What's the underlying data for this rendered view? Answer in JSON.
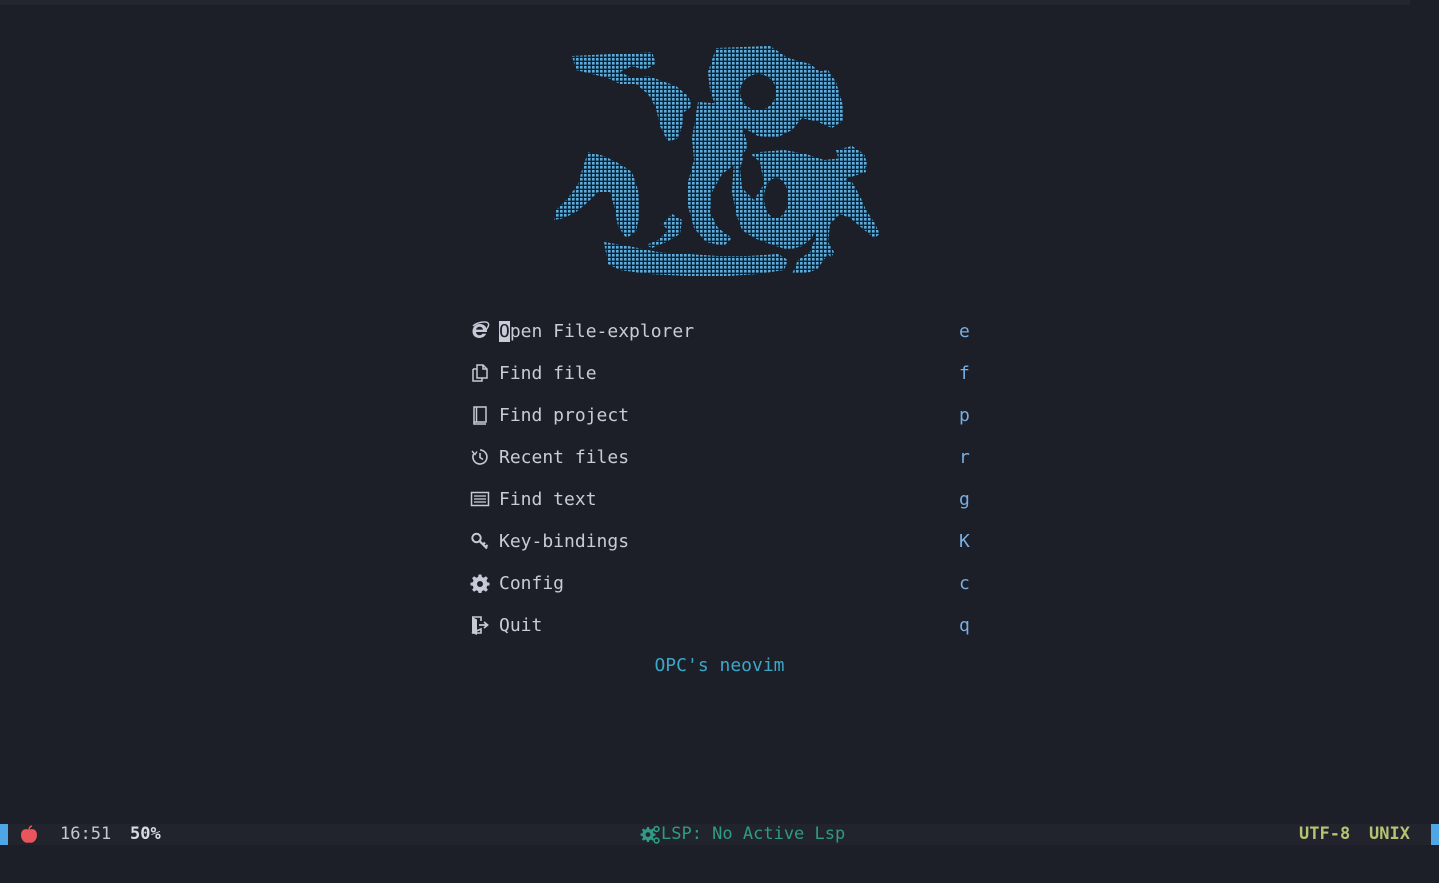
{
  "menu": [
    {
      "icon": "internet-explorer-icon",
      "label_first": "O",
      "label_rest": "pen File-explorer",
      "key": "e"
    },
    {
      "icon": "files-icon",
      "label": "Find file",
      "key": "f"
    },
    {
      "icon": "book-icon",
      "label": "Find project",
      "key": "p"
    },
    {
      "icon": "history-icon",
      "label": "Recent files",
      "key": "r"
    },
    {
      "icon": "text-lines-icon",
      "label": "Find text",
      "key": "g"
    },
    {
      "icon": "key-icon",
      "label": "Key-bindings",
      "key": "K"
    },
    {
      "icon": "gear-icon",
      "label": "Config",
      "key": "c"
    },
    {
      "icon": "exit-icon",
      "label": "Quit",
      "key": "q"
    }
  ],
  "footer": "OPC's neovim",
  "statusline": {
    "time": "16:51",
    "percent": "50%",
    "lsp": "LSP: No Active Lsp",
    "encoding": "UTF-8",
    "format": "UNIX"
  },
  "colors": {
    "background": "#1c1e28",
    "logo": "#5aafe0",
    "accent": "#4fa6e6",
    "footer": "#3ba7c7",
    "lsp": "#2f9b87",
    "encoding": "#b4c272"
  }
}
